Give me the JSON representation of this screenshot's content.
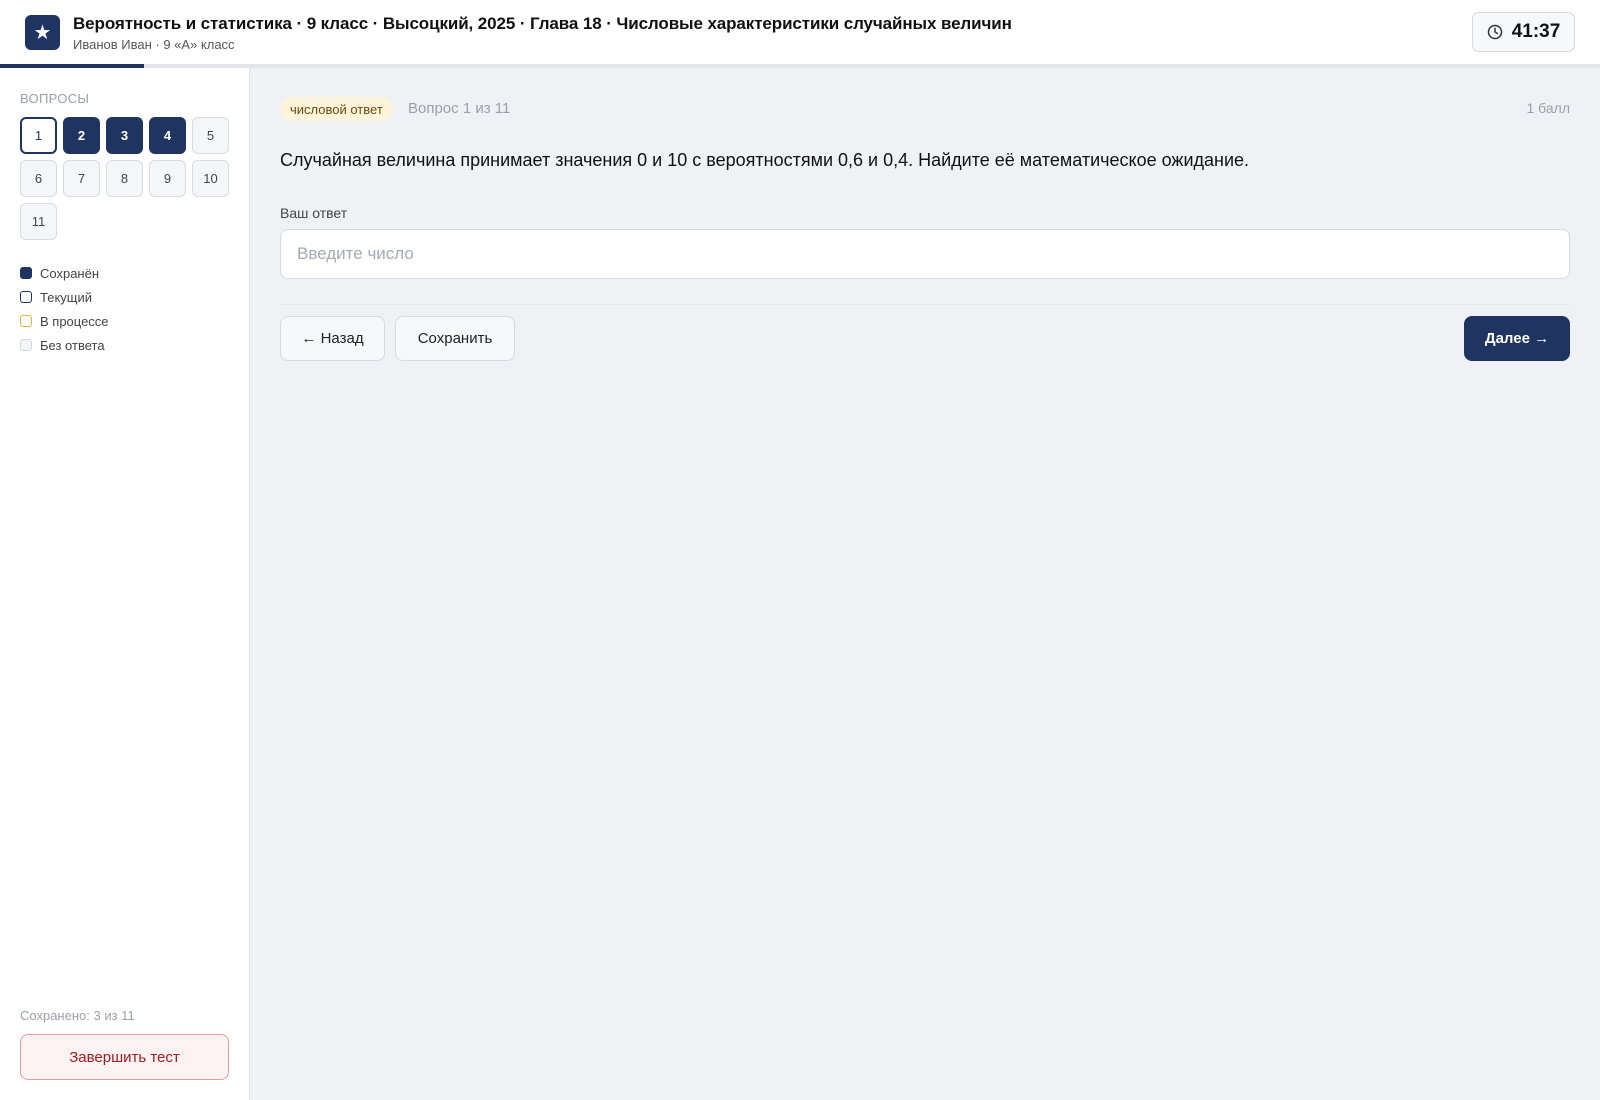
{
  "header": {
    "logo_glyph": "★",
    "title": "Вероятность и статистика · 9 класс · Высоцкий, 2025 · Глава 18 · Числовые характеристики случайных величин",
    "subtitle": "Иванов Иван · 9 «А» класс",
    "timer": "41:37",
    "timer_icon": "clock-icon"
  },
  "progress": {
    "fraction": 0.09
  },
  "sidebar": {
    "heading": "Вопросы",
    "questions": [
      {
        "label": "1",
        "state": "current"
      },
      {
        "label": "2",
        "state": "saved"
      },
      {
        "label": "3",
        "state": "saved"
      },
      {
        "label": "4",
        "state": "saved"
      },
      {
        "label": "5",
        "state": "unanswered"
      },
      {
        "label": "6",
        "state": "unanswered"
      },
      {
        "label": "7",
        "state": "unanswered"
      },
      {
        "label": "8",
        "state": "unanswered"
      },
      {
        "label": "9",
        "state": "unanswered"
      },
      {
        "label": "10",
        "state": "unanswered"
      },
      {
        "label": "11",
        "state": "unanswered"
      }
    ],
    "legend": [
      {
        "label": "Сохранён",
        "kind": "saved"
      },
      {
        "label": "Текущий",
        "kind": "current"
      },
      {
        "label": "В процессе",
        "kind": "progress"
      },
      {
        "label": "Без ответа",
        "kind": "none"
      }
    ],
    "saved_count": "Сохранено: 3 из 11",
    "finish_label": "Завершить тест"
  },
  "main": {
    "tag": "числовой ответ",
    "question_number": "Вопрос 1 из 11",
    "points": "1 балл",
    "question_text": "Случайная величина принимает значения 0 и 10 с вероятностями 0,6 и 0,4. Найдите её математическое ожидание.",
    "answer_label": "Ваш ответ",
    "answer_placeholder": "Введите число",
    "answer_value": "",
    "back_label": "← Назад",
    "save_label": "Сохранить",
    "next_label": "Далее →"
  },
  "colors": {
    "brand": "#1f3461",
    "in_progress": "#e9b43a",
    "danger": "#a21d1d"
  }
}
